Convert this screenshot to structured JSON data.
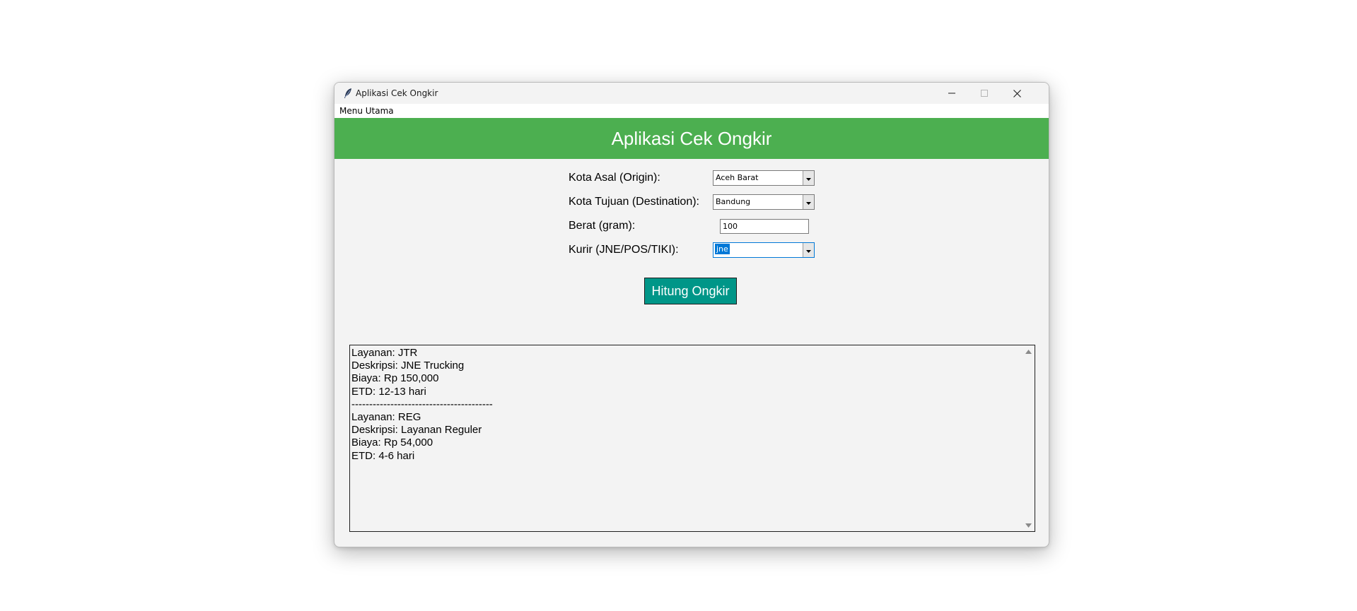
{
  "window": {
    "title": "Aplikasi Cek Ongkir"
  },
  "menu": {
    "items": [
      "Menu Utama"
    ]
  },
  "header": {
    "title": "Aplikasi Cek Ongkir",
    "color": "#4caf50"
  },
  "form": {
    "origin_label": "Kota Asal (Origin):",
    "origin_value": "Aceh Barat",
    "destination_label": "Kota Tujuan (Destination):",
    "destination_value": "Bandung",
    "weight_label": "Berat (gram):",
    "weight_value": "100",
    "courier_label": "Kurir (JNE/POS/TIKI):",
    "courier_value": "jne"
  },
  "action": {
    "button_label": "Hitung Ongkir",
    "button_color": "#009688"
  },
  "result": {
    "lines": [
      "Layanan: JTR",
      "Deskripsi: JNE Trucking",
      "Biaya: Rp 150,000",
      "ETD: 12-13 hari",
      "----------------------------------------",
      "Layanan: REG",
      "Deskripsi: Layanan Reguler",
      "Biaya: Rp 54,000",
      "ETD: 4-6 hari"
    ]
  },
  "icons": {
    "app": "feather-icon",
    "minimize": "minimize-icon",
    "maximize": "maximize-icon",
    "close": "close-icon",
    "dropdown": "chevron-down-icon",
    "scroll_up": "scroll-up-arrow-icon",
    "scroll_down": "scroll-down-arrow-icon"
  }
}
